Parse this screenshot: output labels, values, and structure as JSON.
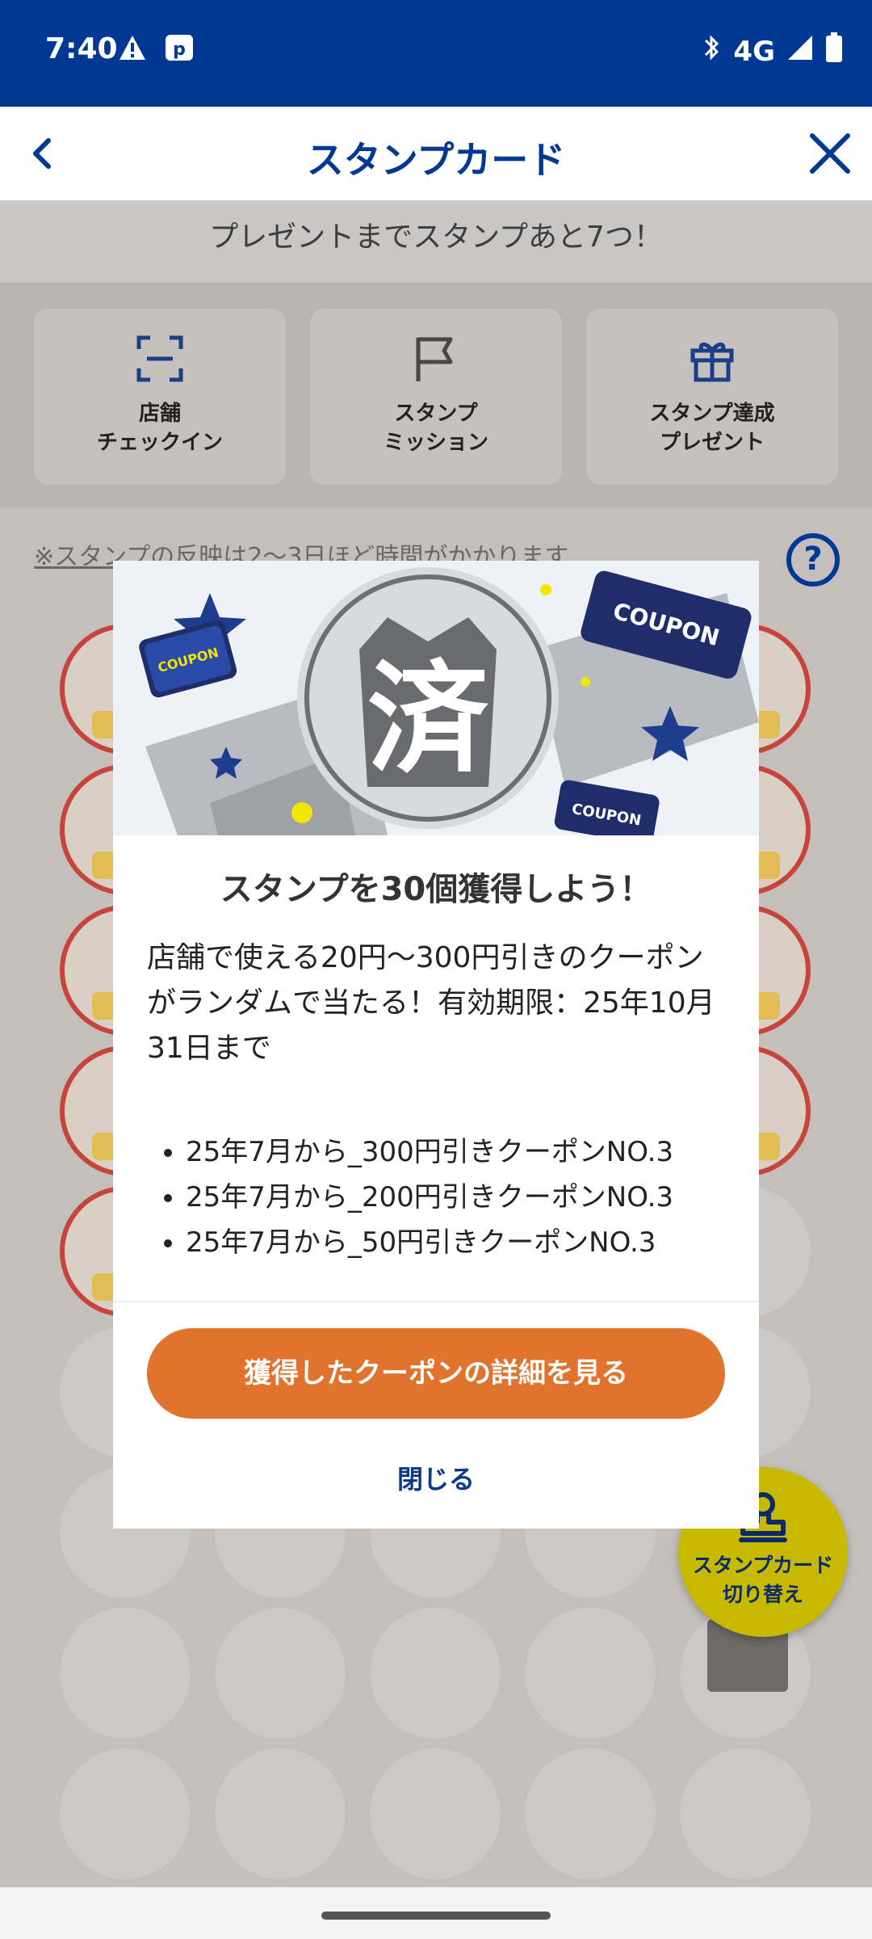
{
  "status_bar": {
    "time": "7:40",
    "network": "4G",
    "icons": [
      "warning-icon",
      "p-app-icon",
      "bluetooth-icon",
      "signal-icon",
      "battery-icon"
    ]
  },
  "header": {
    "title": "スタンプカード",
    "back_icon": "chevron-left-icon",
    "close_icon": "close-icon"
  },
  "notice": "プレゼントまでスタンプあと7つ！",
  "menu": [
    {
      "label": "店舗\nチェックイン",
      "icon": "scan-icon"
    },
    {
      "label": "スタンプ\nミッション",
      "icon": "flag-icon"
    },
    {
      "label": "スタンプ達成\nプレゼント",
      "icon": "gift-icon"
    }
  ],
  "note_link": "※スタンプの反映は2〜3日ほど時間がかかります",
  "help_label": "?",
  "stamp_grid": {
    "rows": 9,
    "columns": 5,
    "collected": 23
  },
  "fab_label": "スタンプカード\n切り替え",
  "modal": {
    "hero_text": "済",
    "hero_badges": [
      "COUPON",
      "COUPON",
      "COUPON"
    ],
    "title": "スタンプを30個獲得しよう！",
    "description": "店舗で使える20円〜300円引きのクーポンがランダムで当たる！有効期限：25年10月31日まで",
    "items": [
      "25年7月から_300円引きクーポンNO.3",
      "25年7月から_200円引きクーポンNO.3",
      "25年7月から_50円引きクーポンNO.3"
    ],
    "primary_button": "獲得したクーポンの詳細を見る",
    "close_button": "閉じる"
  },
  "colors": {
    "brand_blue": "#003894",
    "accent_orange": "#e0742f",
    "fab_yellow": "#c7b900"
  }
}
